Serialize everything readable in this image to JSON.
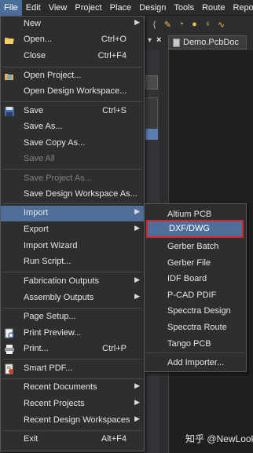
{
  "menubar": [
    {
      "label": "File"
    },
    {
      "label": "Edit"
    },
    {
      "label": "View"
    },
    {
      "label": "Project"
    },
    {
      "label": "Place"
    },
    {
      "label": "Design"
    },
    {
      "label": "Tools"
    },
    {
      "label": "Route"
    },
    {
      "label": "Repo"
    }
  ],
  "document_tab": {
    "label": "Demo.PcbDoc"
  },
  "file_menu": {
    "new": {
      "label": "New"
    },
    "open": {
      "label": "Open...",
      "shortcut": "Ctrl+O"
    },
    "close": {
      "label": "Close",
      "shortcut": "Ctrl+F4"
    },
    "open_project": {
      "label": "Open Project..."
    },
    "open_workspace": {
      "label": "Open Design Workspace..."
    },
    "save": {
      "label": "Save",
      "shortcut": "Ctrl+S"
    },
    "save_as": {
      "label": "Save As..."
    },
    "save_copy_as": {
      "label": "Save Copy As..."
    },
    "save_all": {
      "label": "Save All"
    },
    "save_project_as": {
      "label": "Save Project As..."
    },
    "save_workspace_as": {
      "label": "Save Design Workspace As..."
    },
    "import": {
      "label": "Import"
    },
    "export": {
      "label": "Export"
    },
    "import_wizard": {
      "label": "Import Wizard"
    },
    "run_script": {
      "label": "Run Script..."
    },
    "fabrication_outputs": {
      "label": "Fabrication Outputs"
    },
    "assembly_outputs": {
      "label": "Assembly Outputs"
    },
    "page_setup": {
      "label": "Page Setup..."
    },
    "print_preview": {
      "label": "Print Preview..."
    },
    "print": {
      "label": "Print...",
      "shortcut": "Ctrl+P"
    },
    "smart_pdf": {
      "label": "Smart PDF..."
    },
    "recent_documents": {
      "label": "Recent Documents"
    },
    "recent_projects": {
      "label": "Recent Projects"
    },
    "recent_workspaces": {
      "label": "Recent Design Workspaces"
    },
    "exit": {
      "label": "Exit",
      "shortcut": "Alt+F4"
    }
  },
  "import_submenu": [
    {
      "label": "Altium PCB"
    },
    {
      "label": "DXF/DWG"
    },
    {
      "label": "Gerber Batch"
    },
    {
      "label": "Gerber File"
    },
    {
      "label": "IDF Board"
    },
    {
      "label": "P-CAD PDIF"
    },
    {
      "label": "Specctra Design"
    },
    {
      "label": "Specctra Route"
    },
    {
      "label": "Tango PCB"
    },
    {
      "label": "Add Importer..."
    }
  ],
  "watermark": "知乎 @NewLook",
  "colors": {
    "menu_bg": "#2e2e2e",
    "highlight": "#4f6f9a",
    "frame_red": "#d3262b",
    "disabled_text": "#808080"
  }
}
